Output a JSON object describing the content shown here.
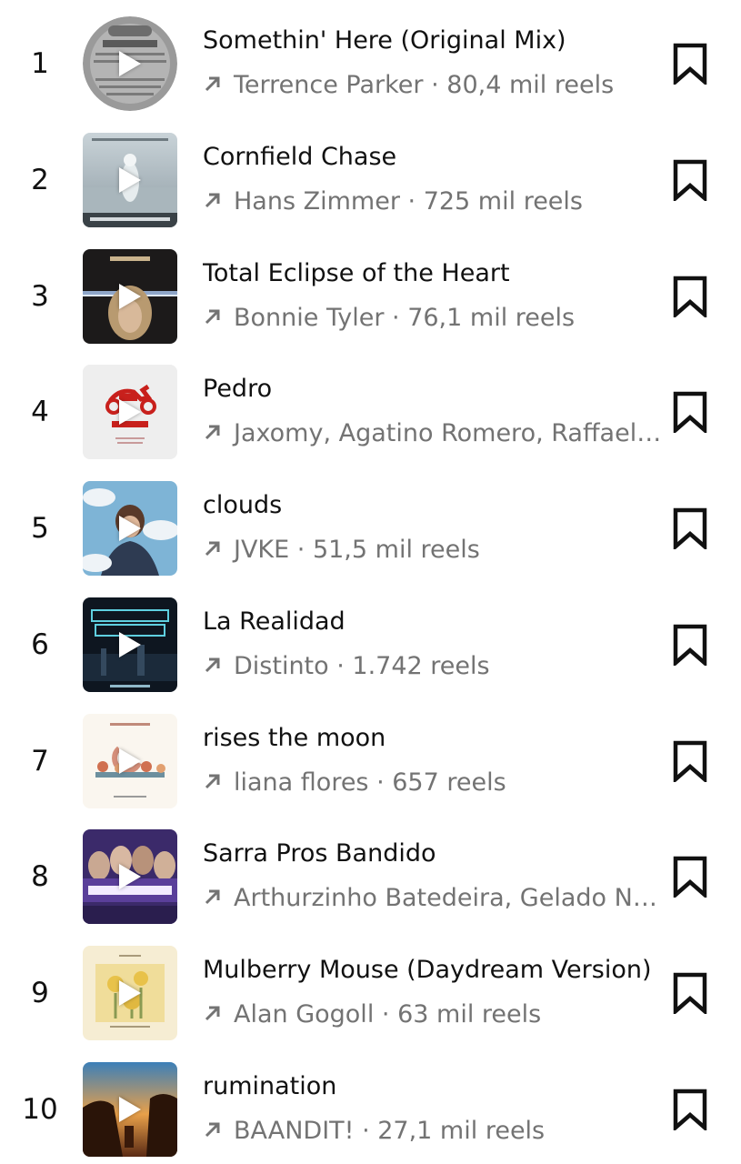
{
  "tracks": [
    {
      "rank": "1",
      "title": "Somethin' Here (Original Mix)",
      "artist": "Terrence Parker",
      "reels": "80,4 mil reels",
      "cover_icon": "vinyl-record-cover"
    },
    {
      "rank": "2",
      "title": "Cornfield Chase",
      "artist": "Hans Zimmer",
      "reels": "725 mil reels",
      "cover_icon": "interstellar-cover"
    },
    {
      "rank": "3",
      "title": "Total Eclipse of the Heart",
      "artist": "Bonnie Tyler",
      "reels": "76,1 mil reels",
      "cover_icon": "bonnie-tyler-cover"
    },
    {
      "rank": "4",
      "title": "Pedro",
      "artist": "Jaxomy, Agatino Romero, Raffaella Carrà",
      "reels": "",
      "cover_icon": "pedro-scooter-cover"
    },
    {
      "rank": "5",
      "title": "clouds",
      "artist": "JVKE",
      "reels": "51,5 mil reels",
      "cover_icon": "clouds-cover"
    },
    {
      "rank": "6",
      "title": "La Realidad",
      "artist": "Distinto",
      "reels": "1.742 reels",
      "cover_icon": "noches-tristes-cover"
    },
    {
      "rank": "7",
      "title": "rises the moon",
      "artist": "liana flores",
      "reels": "657 reels",
      "cover_icon": "recently-cover"
    },
    {
      "rank": "8",
      "title": "Sarra Pros Bandido",
      "artist": "Arthurzinho Batedeira, Gelado No Talento",
      "reels": "",
      "cover_icon": "sarra-bandido-cover"
    },
    {
      "rank": "9",
      "title": "Mulberry Mouse (Daydream Version)",
      "artist": "Alan Gogoll",
      "reels": "63 mil reels",
      "cover_icon": "mulberry-mouse-cover"
    },
    {
      "rank": "10",
      "title": "rumination",
      "artist": "BAANDIT!",
      "reels": "27,1 mil reels",
      "cover_icon": "rumination-cover"
    }
  ],
  "colors": {
    "text": "#111111",
    "secondary_text": "#737373",
    "background": "#ffffff"
  },
  "icons": {
    "trend": "arrow-up-right-icon",
    "save": "bookmark-icon",
    "play": "play-icon"
  },
  "separator": " · "
}
